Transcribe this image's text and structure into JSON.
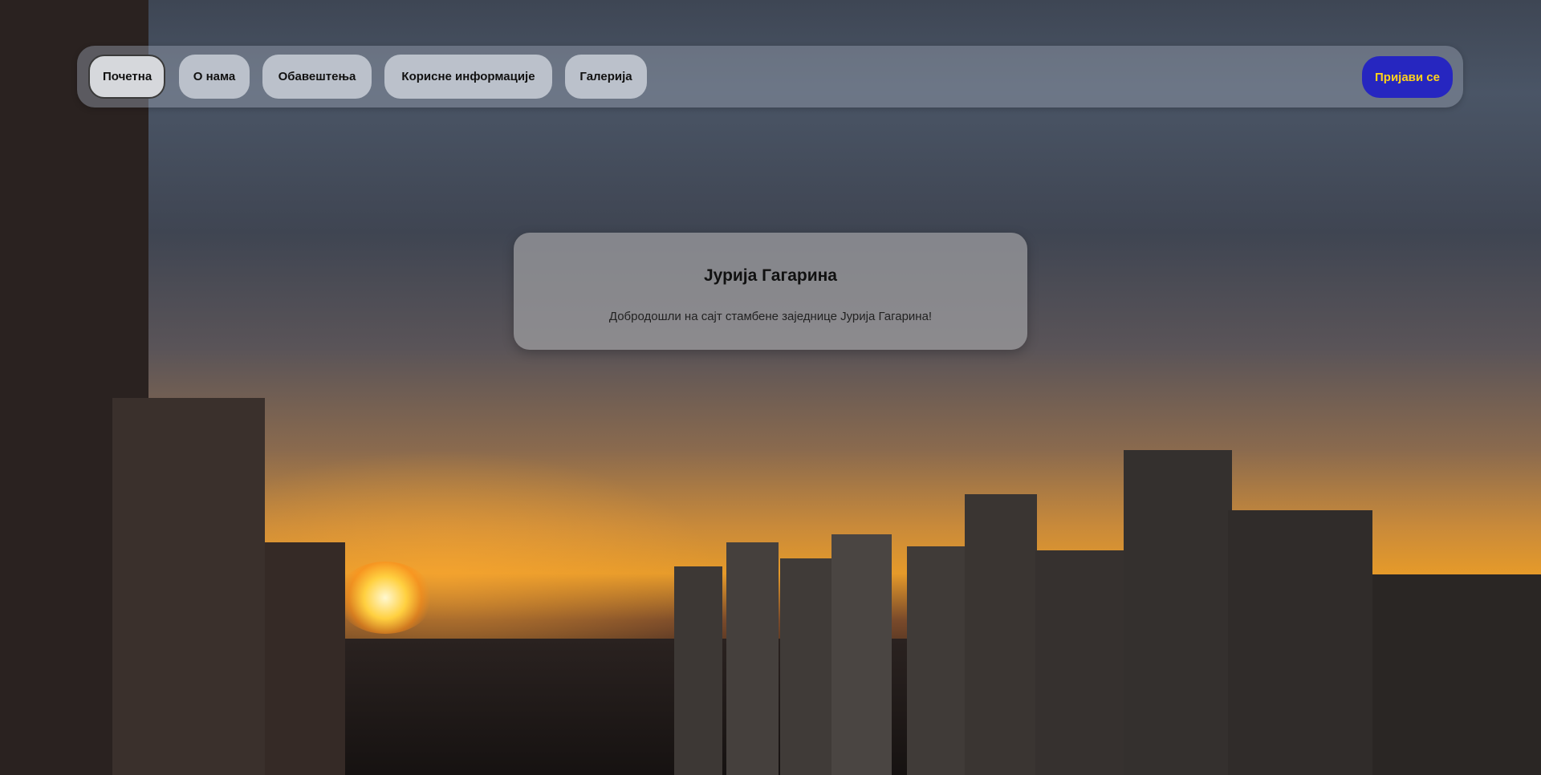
{
  "nav": {
    "items": [
      {
        "label": "Почетна",
        "active": true
      },
      {
        "label": "О нама",
        "active": false
      },
      {
        "label": "Обавештења",
        "active": false
      },
      {
        "label": "Корисне информације",
        "active": false
      },
      {
        "label": "Галерија",
        "active": false
      }
    ],
    "login_label": "Пријави се"
  },
  "hero": {
    "title": "Јурија Гагарина",
    "subtitle": "Добродошли на сајт стамбене заједнице Јурија Гагарина!"
  },
  "colors": {
    "login_bg": "#2626c0",
    "login_text": "#ffd21a"
  }
}
